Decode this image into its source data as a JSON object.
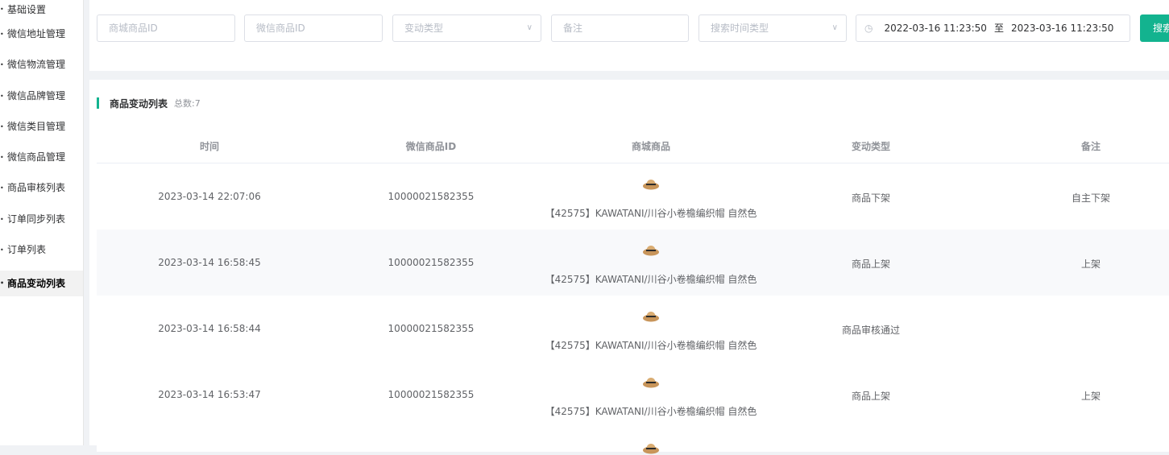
{
  "sidebar": {
    "items": [
      {
        "label": "基础设置",
        "active": false
      },
      {
        "label": "微信地址管理",
        "active": false
      },
      {
        "label": "微信物流管理",
        "active": false
      },
      {
        "label": "微信品牌管理",
        "active": false
      },
      {
        "label": "微信类目管理",
        "active": false
      },
      {
        "label": "微信商品管理",
        "active": false
      },
      {
        "label": "商品审核列表",
        "active": false
      },
      {
        "label": "订单同步列表",
        "active": false
      },
      {
        "label": "订单列表",
        "active": false
      },
      {
        "label": "商品变动列表",
        "active": true
      }
    ]
  },
  "filter": {
    "mall_product_id_placeholder": "商城商品ID",
    "wechat_product_id_placeholder": "微信商品ID",
    "change_type_placeholder": "变动类型",
    "remark_placeholder": "备注",
    "time_type_placeholder": "搜索时间类型",
    "date_start": "2022-03-16 11:23:50",
    "date_separator": "至",
    "date_end": "2023-03-16 11:23:50",
    "search_label": "搜索"
  },
  "list": {
    "title": "商品变动列表",
    "count": "总数:7",
    "columns": [
      "时间",
      "微信商品ID",
      "商城商品",
      "变动类型",
      "备注"
    ],
    "rows": [
      {
        "time": "2023-03-14 22:07:06",
        "wechat_id": "10000021582355",
        "product": "【42575】KAWATANI/川谷小卷檐编织帽 自然色",
        "change_type": "商品下架",
        "remark": "自主下架"
      },
      {
        "time": "2023-03-14 16:58:45",
        "wechat_id": "10000021582355",
        "product": "【42575】KAWATANI/川谷小卷檐编织帽 自然色",
        "change_type": "商品上架",
        "remark": "上架"
      },
      {
        "time": "2023-03-14 16:58:44",
        "wechat_id": "10000021582355",
        "product": "【42575】KAWATANI/川谷小卷檐编织帽 自然色",
        "change_type": "商品审核通过",
        "remark": ""
      },
      {
        "time": "2023-03-14 16:53:47",
        "wechat_id": "10000021582355",
        "product": "【42575】KAWATANI/川谷小卷檐编织帽 自然色",
        "change_type": "商品上架",
        "remark": "上架"
      }
    ]
  },
  "colors": {
    "accent": "#13b38f"
  },
  "icons": {
    "product_thumbnail": "straw-hat-icon",
    "clock": "clock-icon",
    "chevron": "chevron-down-icon"
  }
}
